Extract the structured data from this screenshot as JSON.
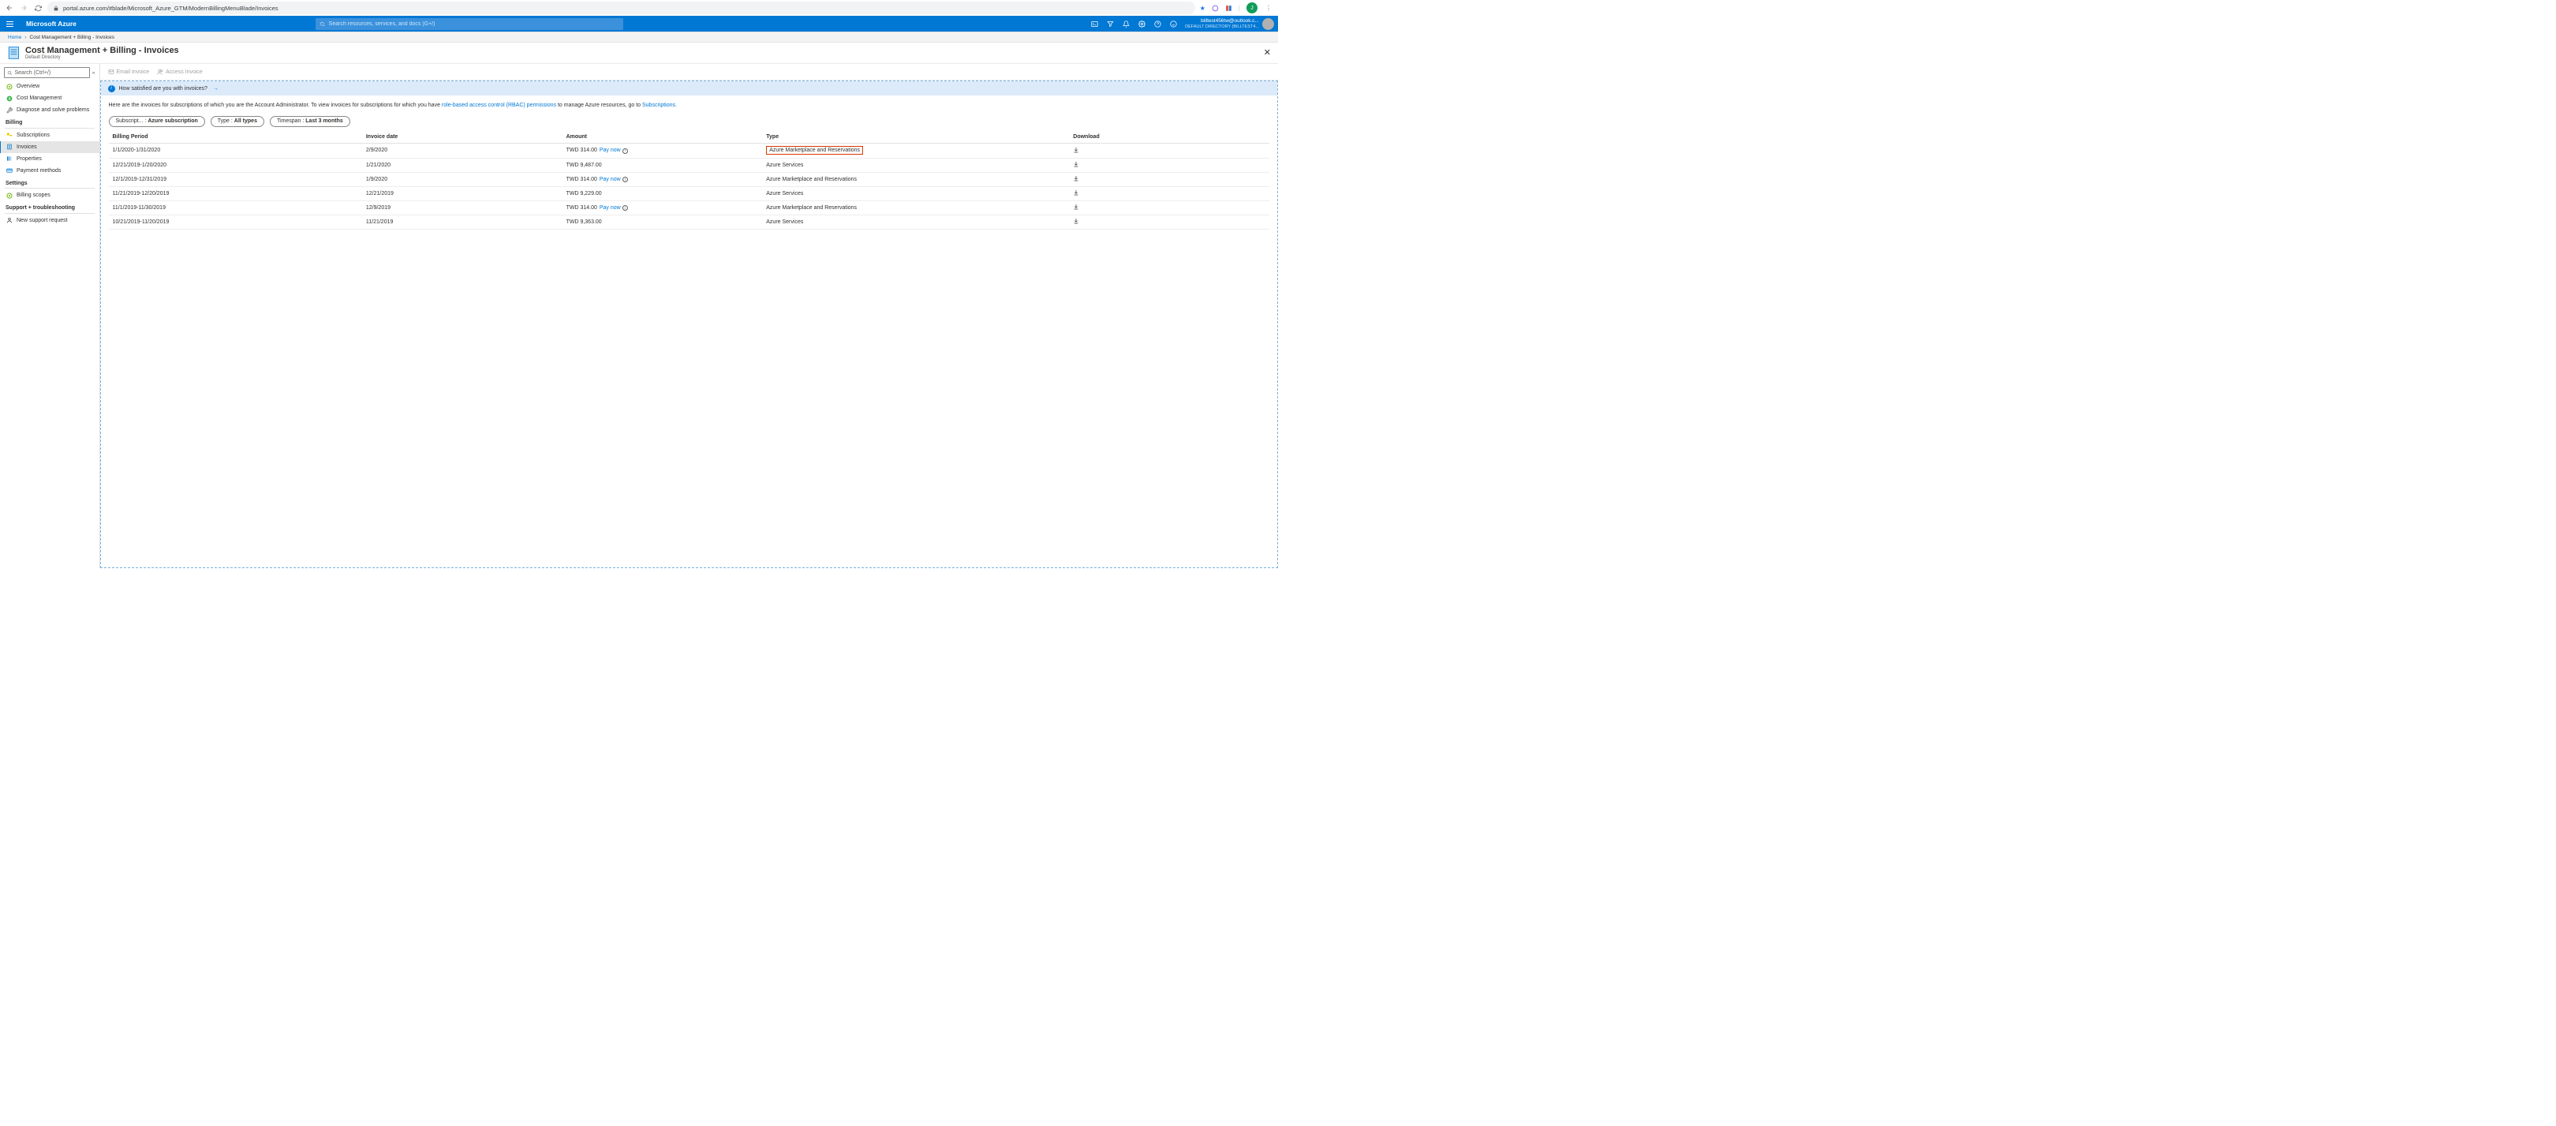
{
  "chrome": {
    "url": "portal.azure.com/#blade/Microsoft_Azure_GTM/ModernBillingMenuBlade/Invoices",
    "avatar_letter": "J"
  },
  "azure_top": {
    "brand": "Microsoft Azure",
    "search_placeholder": "Search resources, services, and docs (G+/)",
    "account_email": "billtest456tw@outlook.c...",
    "account_dir": "DEFAULT DIRECTORY (BILLTEST4..."
  },
  "breadcrumb": {
    "home": "Home",
    "current": "Cost Management + Billing - Invoices"
  },
  "blade": {
    "title": "Cost Management + Billing - Invoices",
    "subtitle": "Default Directory"
  },
  "left_search": "Search (Ctrl+/)",
  "nav": {
    "overview": "Overview",
    "cost_mgmt": "Cost Management",
    "diagnose": "Diagnose and solve problems",
    "billing_header": "Billing",
    "subscriptions": "Subscriptions",
    "invoices": "Invoices",
    "properties": "Properties",
    "payment": "Payment methods",
    "settings_header": "Settings",
    "billing_scopes": "Billing scopes",
    "support_header": "Support + troubleshooting",
    "new_support": "New support request"
  },
  "toolbar": {
    "email": "Email Invoice",
    "access": "Access Invoice"
  },
  "banner": "How satisfied are you with invoices?",
  "desc": {
    "t1": "Here are the invoices for subscriptions of which you are the Account Administrator. To view invoices for subscriptions for which you have ",
    "rbac": "role-based access control (RBAC) permissions",
    "t2": " to manage Azure resources, go to ",
    "subs": "Subscriptions."
  },
  "pills": {
    "sub_label": "Subscript... : ",
    "sub_value": "Azure subscription",
    "type_label": "Type : ",
    "type_value": "All types",
    "time_label": "Timespan : ",
    "time_value": "Last 3 months"
  },
  "table": {
    "headers": {
      "period": "Billing Period",
      "date": "Invoice date",
      "amount": "Amount",
      "type": "Type",
      "download": "Download"
    },
    "paynow": "Pay now",
    "rows": [
      {
        "period": "1/1/2020-1/31/2020",
        "date": "2/9/2020",
        "amount": "TWD 314.00",
        "paynow": true,
        "type": "Azure Marketplace and Reservations",
        "highlight": true
      },
      {
        "period": "12/21/2019-1/20/2020",
        "date": "1/21/2020",
        "amount": "TWD 9,487.00",
        "paynow": false,
        "type": "Azure Services"
      },
      {
        "period": "12/1/2019-12/31/2019",
        "date": "1/9/2020",
        "amount": "TWD 314.00",
        "paynow": true,
        "type": "Azure Marketplace and Reservations"
      },
      {
        "period": "11/21/2019-12/20/2019",
        "date": "12/21/2019",
        "amount": "TWD 9,229.00",
        "paynow": false,
        "type": "Azure Services"
      },
      {
        "period": "11/1/2019-11/30/2019",
        "date": "12/9/2019",
        "amount": "TWD 314.00",
        "paynow": true,
        "type": "Azure Marketplace and Reservations"
      },
      {
        "period": "10/21/2019-11/20/2019",
        "date": "11/21/2019",
        "amount": "TWD 9,363.00",
        "paynow": false,
        "type": "Azure Services"
      }
    ]
  }
}
